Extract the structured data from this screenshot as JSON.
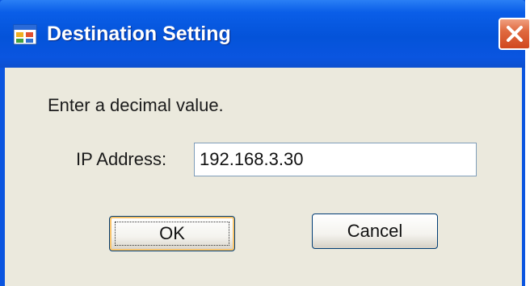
{
  "window": {
    "title": "Destination Setting",
    "icon": "app-window-icon",
    "close_icon": "close-icon"
  },
  "form": {
    "instruction": "Enter a decimal value.",
    "ip_label": "IP Address:",
    "ip_value": "192.168.3.30"
  },
  "buttons": {
    "ok_label": "OK",
    "cancel_label": "Cancel"
  },
  "colors": {
    "titlebar": "#0a55e0",
    "client_bg": "#ebe9dd",
    "close_button": "#d85a30"
  }
}
